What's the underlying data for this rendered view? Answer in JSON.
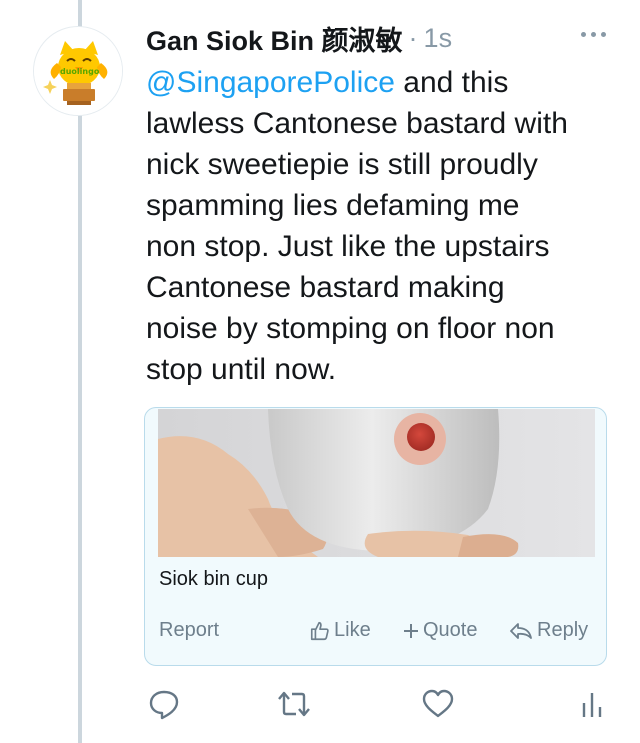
{
  "tweet": {
    "author_name": "Gan Siok Bin",
    "author_cjk": "颜淑敏",
    "separator": "·",
    "timestamp": "1s",
    "mention": "@SingaporePolice",
    "body_lines": [
      " and this",
      "lawless Cantonese bastard with",
      "nick sweetiepie is still proudly",
      "spamming lies defaming me",
      "non stop. Just like the upstairs",
      "Cantonese bastard making",
      "noise by stomping on floor non",
      "stop until now."
    ]
  },
  "avatar": {
    "logo_text": "duolingo",
    "icon": "duolingo-owl-avatar"
  },
  "card": {
    "title": "Siok bin cup",
    "image": "ceramic-cup-photo",
    "report_label": "Report",
    "like_label": "Like",
    "quote_label": "Quote",
    "reply_label": "Reply"
  },
  "colors": {
    "accent": "#1da1f2",
    "text": "#14171a",
    "muted": "#8899a6",
    "card_bg": "#f1fafd",
    "card_border": "#b9dbeb",
    "thread_line": "#ccd6dd"
  },
  "icons": [
    "more-icon",
    "reply-icon",
    "retweet-icon",
    "like-icon",
    "stats-icon",
    "thumb-up-icon",
    "plus-icon",
    "reply-arrow-icon"
  ]
}
